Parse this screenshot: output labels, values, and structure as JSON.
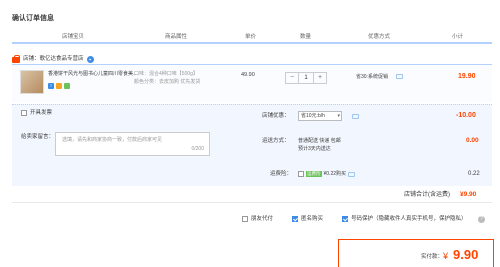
{
  "page_title": "确认订单信息",
  "columns": [
    "店铺宝贝",
    "商品属性",
    "单价",
    "数量",
    "优惠方式",
    "小计"
  ],
  "shop": {
    "label": "店铺：歌亿达食品专营店"
  },
  "item": {
    "title": "香港饼干风光与图书心儿童四川零食美…",
    "attr_taste": "口味：混合4种口味【500g】",
    "attr_color": "颜色分类：去皮加购 优先发货",
    "price": "49.90",
    "quantity": "1",
    "promo": "省30:系统促销",
    "subtotal": "19.90",
    "badges": [
      "7",
      "",
      ""
    ]
  },
  "options": {
    "anonymous_label": "开具发票",
    "message_label": "给卖家留言：",
    "message_placeholder": "选填，请先和商家协商一致，付款后商家可见",
    "message_count": "0/200",
    "shop_discount_label": "店铺优惠：",
    "shop_discount_value": "省10元:b/h",
    "shop_discount_amount": "-10.00",
    "shipping_label": "运送方式：",
    "shipping_value": "普通配送 快递 包邮",
    "shipping_note": "预计3天内送达",
    "shipping_amount": "0.00",
    "insurance_label": "运费险：",
    "insurance_tag": "运费险",
    "insurance_value": "¥0.22购买",
    "insurance_amount": "0.22"
  },
  "shop_total": {
    "label": "店铺合计(含运费)",
    "value": "¥9.90"
  },
  "bottom_options": {
    "peer_pay": "朋友代付",
    "anonymous": "匿名购买",
    "privacy": "号码保护（隐藏收件人真实手机号，保护隐私）"
  },
  "pay": {
    "label": "实付款：",
    "currency": "¥",
    "amount": "9.90"
  },
  "colors": {
    "accent": "#f40",
    "blue": "#3c8ce7",
    "header_line": "#b2d1ff"
  }
}
